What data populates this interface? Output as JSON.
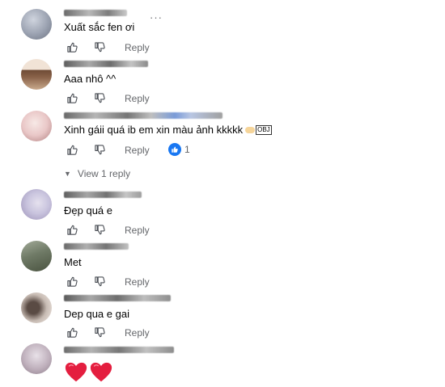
{
  "ui": {
    "reply_label": "Reply",
    "more_label": "···",
    "view_replies_label": "View 1 reply",
    "view_replies_chevron": "▼"
  },
  "comments": [
    {
      "text": "Xuất sắc fen ơi",
      "avatar_colors": [
        "#9aa1b0",
        "#cfd4de",
        "#6b7280"
      ]
    },
    {
      "text": "Aaa nhô ^^",
      "avatar_colors": [
        "#f1e3d6",
        "#6f4b35",
        "#c9a98c"
      ]
    },
    {
      "text": "Xinh gáii quá ib em xin màu ảnh kkkkk",
      "obj_label": "OBJ",
      "reactions": "1",
      "avatar_colors": [
        "#e9c7c7",
        "#f7e9e6",
        "#b07f7f"
      ]
    },
    {
      "text": "Đẹp quá e",
      "avatar_colors": [
        "#c9c4de",
        "#9a8fb6",
        "#e5e1ee"
      ]
    },
    {
      "text": "Met",
      "avatar_colors": [
        "#6f7a66",
        "#4a5340",
        "#a3ab99"
      ]
    },
    {
      "text": "Dep qua e gai",
      "avatar_colors": [
        "#f4ece6",
        "#5a4b44",
        "#c7bbb3"
      ]
    },
    {
      "text": "❤️❤️",
      "avatar_colors": [
        "#e8e1e8",
        "#bfb0bc",
        "#8f7f8d"
      ]
    }
  ],
  "colors": {
    "text": "#050505",
    "secondary": "#65676b",
    "like_blue": "#1877f2",
    "heart_red": "#e41e3f"
  }
}
